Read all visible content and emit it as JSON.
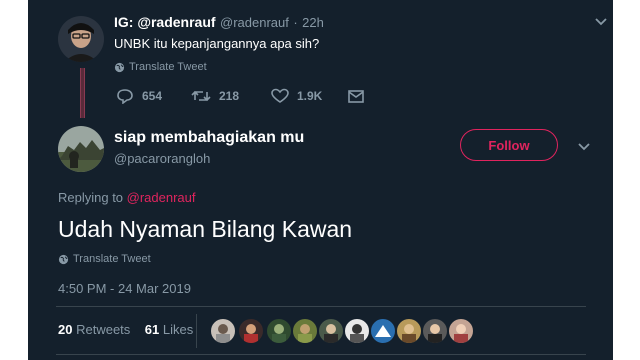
{
  "tweet1": {
    "display_name": "IG: @radenrauf",
    "handle": "@radenrauf",
    "sep": "·",
    "time": "22h",
    "text": "UNBK itu kepanjangannya apa sih?",
    "translate": "Translate Tweet",
    "replies": "654",
    "retweets": "218",
    "likes": "1.9K"
  },
  "tweet2": {
    "display_name": "siap membahagiakan mu",
    "handle": "@pacarorangloh",
    "follow_label": "Follow",
    "replying_prefix": "Replying to ",
    "replying_handle": "@radenrauf",
    "text": "Udah Nyaman Bilang Kawan",
    "translate": "Translate Tweet",
    "timestamp": "4:50 PM - 24 Mar 2019",
    "retweets_count": "20",
    "retweets_label": "Retweets",
    "likes_count": "61",
    "likes_label": "Likes"
  },
  "colors": {
    "background": "#14202c",
    "muted_text": "#8899a6",
    "accent_pink": "#e0245e",
    "divider": "#38444d"
  },
  "icons": [
    "reply-icon",
    "retweet-icon",
    "like-icon",
    "dm-icon",
    "globe-icon",
    "chevron-down-icon"
  ]
}
